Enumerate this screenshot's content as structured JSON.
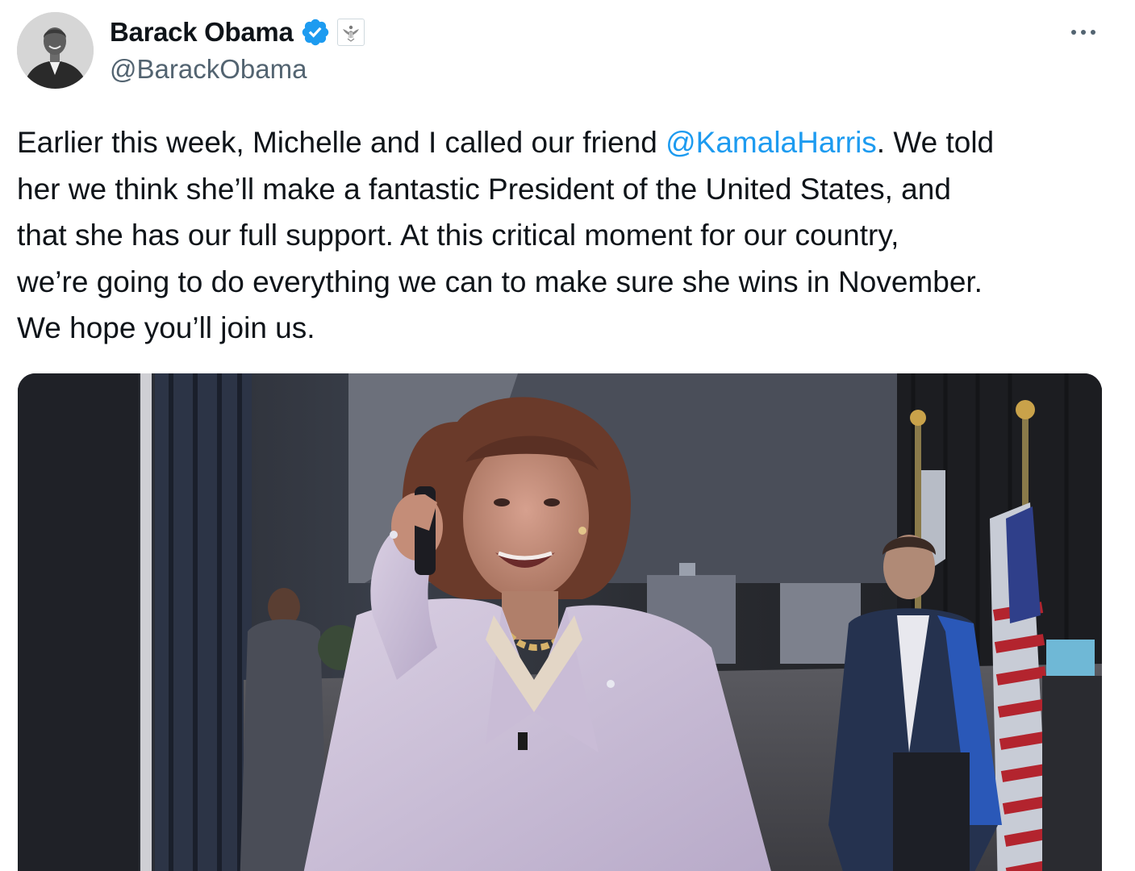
{
  "author": {
    "display_name": "Barack Obama",
    "handle": "@BarackObama",
    "verified_icon": "verified-badge-icon",
    "affiliation_icon": "us-government-seal-icon",
    "avatar_icon": "profile-photo"
  },
  "menu": {
    "more_icon": "more-options-icon"
  },
  "tweet": {
    "line1_before": "Earlier this week, Michelle and I called our friend ",
    "mention": "@KamalaHarris",
    "line1_after": ". We told",
    "line2": "her we think she’ll make a fantastic President of the United States, and",
    "line3": "that she has our full support. At this critical moment for our country,",
    "line4": "we’re going to do everything we can to make sure she wins in November.",
    "line5": "We hope you’ll join us."
  },
  "media": {
    "type": "video-still",
    "description_icon": "photo-media"
  },
  "colors": {
    "accent": "#1d9bf0",
    "text": "#0f1419",
    "secondary": "#536471",
    "verified": "#1d9bf0"
  }
}
